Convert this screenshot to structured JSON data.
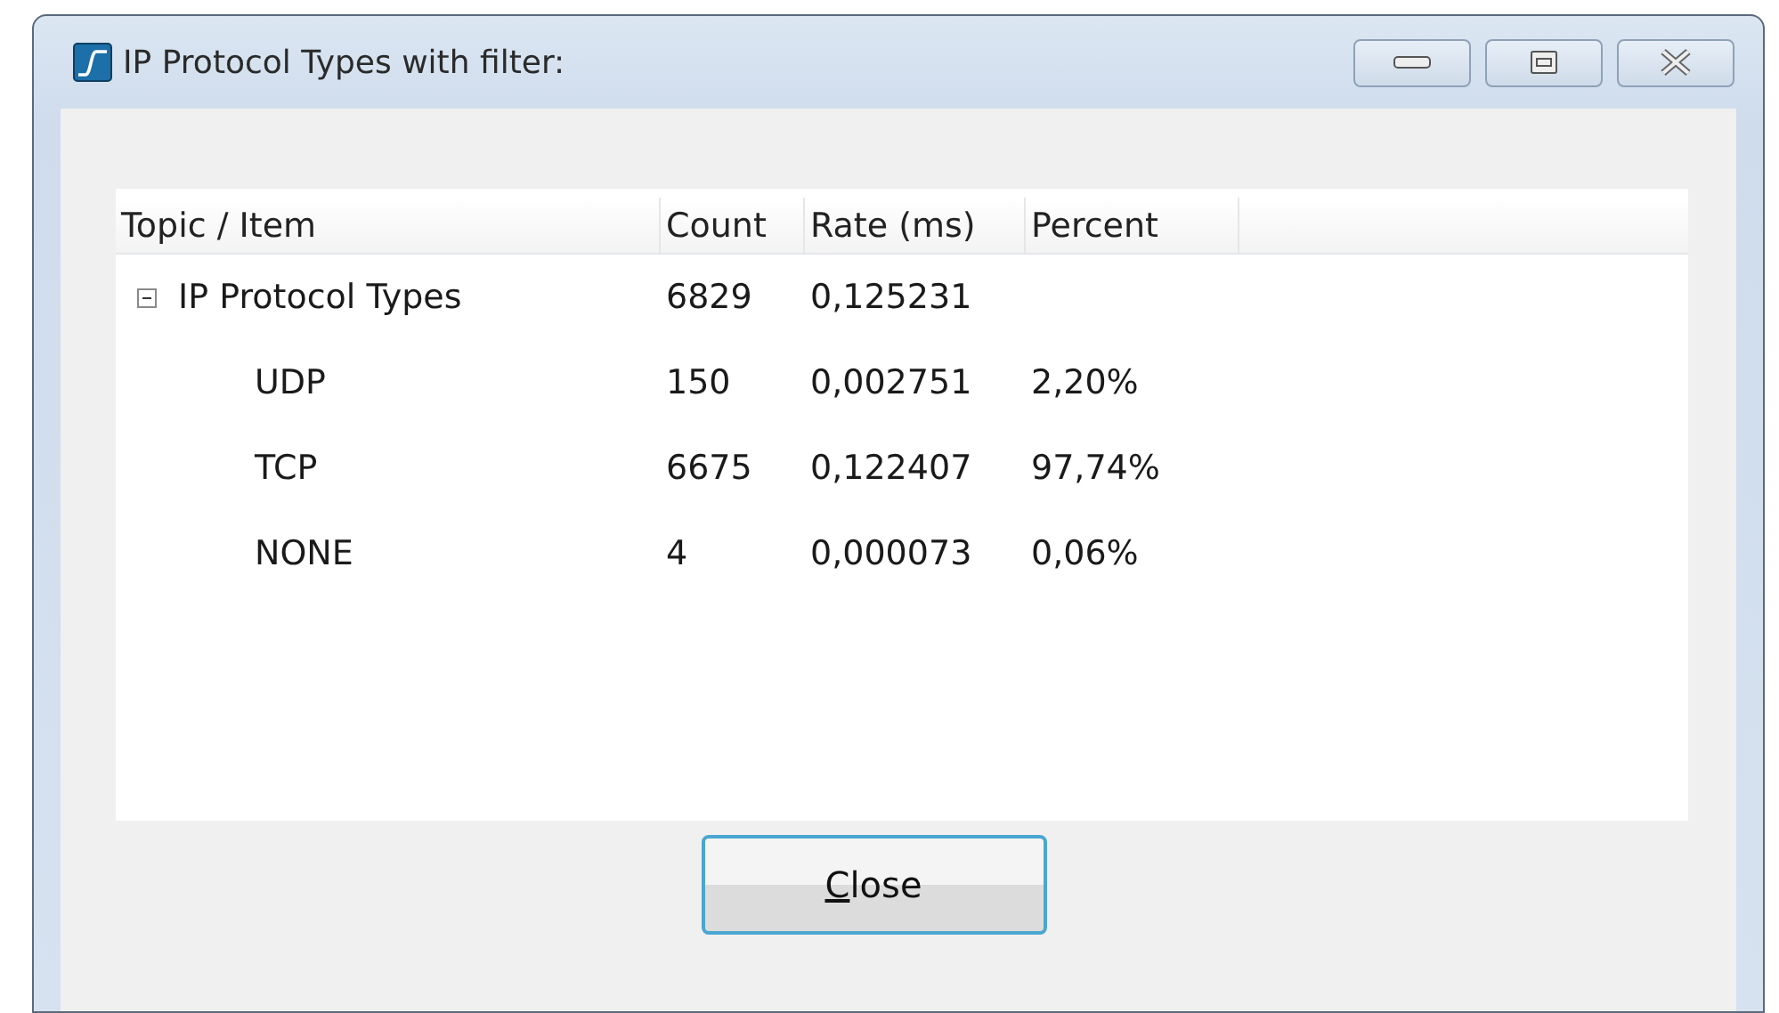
{
  "window": {
    "title": "IP Protocol Types with filter:"
  },
  "tree": {
    "columns": [
      "Topic / Item",
      "Count",
      "Rate (ms)",
      "Percent"
    ],
    "rows": [
      {
        "cells": [
          "IP Protocol Types",
          "6829",
          "0,125231"
        ],
        "expanded": true,
        "children": [
          {
            "cells": [
              "UDP",
              "150",
              "0,002751",
              "2,20%"
            ]
          },
          {
            "cells": [
              "TCP",
              "6675",
              "0,122407",
              "97,74%"
            ]
          },
          {
            "cells": [
              "NONE",
              "4",
              "0,000073",
              "0,06%"
            ]
          }
        ]
      }
    ]
  },
  "close_button": {
    "label": "Close",
    "access_key_underlined": true
  }
}
